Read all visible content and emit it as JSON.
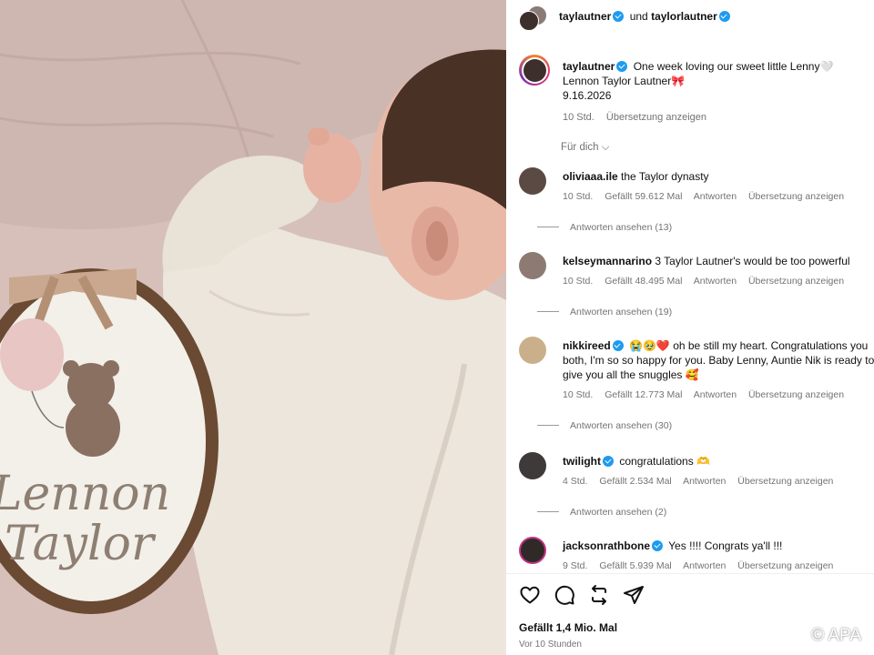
{
  "post": {
    "header": {
      "author": "taylautner",
      "joiner": "und",
      "coauthor": "taylorlautner"
    },
    "caption": {
      "author": "taylautner",
      "line1": "One week loving our sweet little Lenny🤍",
      "line2": "Lennon Taylor Lautner🎀",
      "line3": "9.16.2026",
      "time": "10 Std.",
      "translate": "Übersetzung anzeigen"
    },
    "feed_filter": "Für dich",
    "comments": [
      {
        "user": "oliviaaa.ile",
        "verified": false,
        "text": "the Taylor dynasty",
        "time": "10 Std.",
        "likes": "Gefällt 59.612 Mal",
        "reply": "Antworten",
        "translate": "Übersetzung anzeigen",
        "view_replies": "Antworten ansehen (13)"
      },
      {
        "user": "kelseymannarino",
        "verified": false,
        "text": "3 Taylor Lautner's would be too powerful",
        "time": "10 Std.",
        "likes": "Gefällt 48.495 Mal",
        "reply": "Antworten",
        "translate": "Übersetzung anzeigen",
        "view_replies": "Antworten ansehen (19)"
      },
      {
        "user": "nikkireed",
        "verified": true,
        "text": "😭🥹❤️ oh be still my heart. Congratulations you both, I'm so so happy for you. Baby Lenny, Auntie Nik is ready to give you all the snuggles 🥰",
        "time": "10 Std.",
        "likes": "Gefällt 12.773 Mal",
        "reply": "Antworten",
        "translate": "Übersetzung anzeigen",
        "view_replies": "Antworten ansehen (30)"
      },
      {
        "user": "twilight",
        "verified": true,
        "text": "congratulations 🫶",
        "time": "4 Std.",
        "likes": "Gefällt 2.534 Mal",
        "reply": "Antworten",
        "translate": "Übersetzung anzeigen",
        "view_replies": "Antworten ansehen (2)"
      },
      {
        "user": "jacksonrathbone",
        "verified": true,
        "text": "Yes !!!! Congrats ya'll !!!",
        "time": "9 Std.",
        "likes": "Gefällt 5.939 Mal",
        "reply": "Antworten",
        "translate": "Übersetzung anzeigen"
      }
    ],
    "likes_total": "Gefällt 1,4 Mio. Mal",
    "posted": "Vor 10 Stunden"
  },
  "photo": {
    "embroidery_line1": "Lennon",
    "embroidery_line2": "Taylor"
  },
  "watermark": "© APA",
  "icons": [
    "heart-icon",
    "comment-icon",
    "share-icon",
    "send-icon"
  ]
}
